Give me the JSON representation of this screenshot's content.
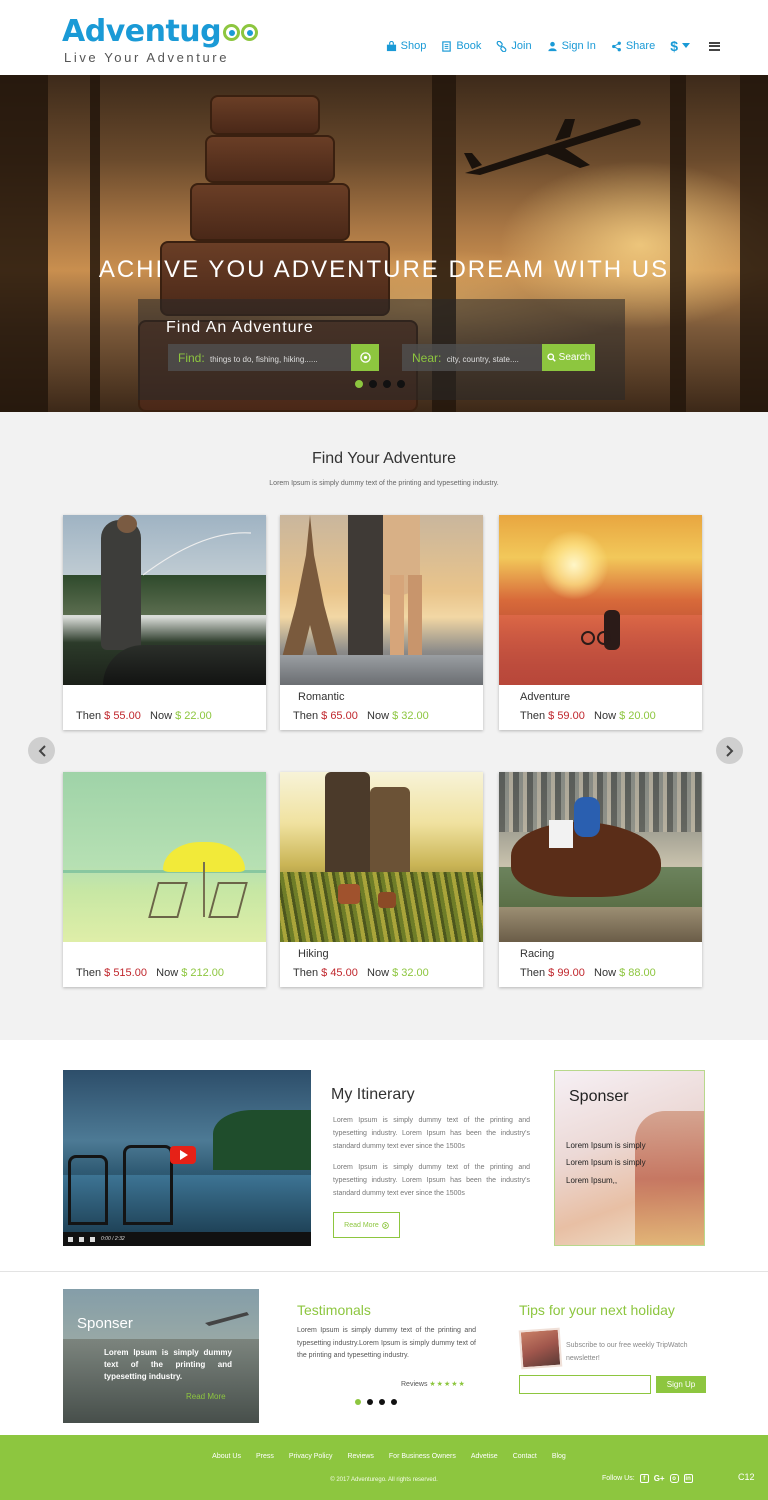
{
  "brand": {
    "name_main": "Adventu",
    "name_tail": "g",
    "tagline": "Live Your Adventure",
    "accent": "#8dc63f",
    "blue": "#1a9ad6"
  },
  "nav": {
    "shop": "Shop",
    "book": "Book",
    "join": "Join",
    "signin": "Sign In",
    "share": "Share",
    "currency": "$"
  },
  "hero": {
    "title": "ACHIVE YOU ADVENTURE DREAM WITH US",
    "search_heading": "Find An Adventure",
    "find_label": "Find:",
    "find_placeholder": "things to do, fishing, hiking......",
    "near_label": "Near:",
    "near_placeholder": "city, country, state....",
    "search_button": "Search",
    "slides": 4,
    "active_slide": 1
  },
  "adventures": {
    "title": "Find Your Adventure",
    "subtitle": "Lorem Ipsum is simply dummy text of the printing and typesetting industry.",
    "then_label": "Then",
    "now_label": "Now",
    "cards": [
      {
        "name": "",
        "then": "$ 55.00",
        "now": "$ 22.00",
        "image": "fishing"
      },
      {
        "name": "Romantic",
        "then": "$ 65.00",
        "now": "$ 32.00",
        "image": "eiffel-tower-couple"
      },
      {
        "name": "Adventure",
        "then": "$ 59.00",
        "now": "$ 20.00",
        "image": "desert-sunset-cyclist"
      },
      {
        "name": "",
        "then": "$ 515.00",
        "now": "$ 212.00",
        "image": "beach-umbrella"
      },
      {
        "name": "Hiking",
        "then": "$ 45.00",
        "now": "$ 32.00",
        "image": "hikers"
      },
      {
        "name": "Racing",
        "then": "$ 99.00",
        "now": "$ 88.00",
        "image": "horse-racing"
      }
    ]
  },
  "itinerary": {
    "title": "My Itinerary",
    "para1": "Lorem Ipsum is simply dummy text of the printing and typesetting industry. Lorem Ipsum has been the industry's standard dummy text ever since the 1500s",
    "para2": "Lorem Ipsum is simply dummy text of the printing and typesetting industry. Lorem Ipsum has been the industry's standard dummy text ever since the 1500s",
    "read_more": "Read More",
    "video_time": "0:00 / 2:32"
  },
  "sponser_card": {
    "title": "Sponser",
    "line1": "Lorem Ipsum is simply",
    "line2": "Lorem Ipsum is simply",
    "line3": "Lorem Ipsum,,"
  },
  "promo": {
    "title": "Sponser",
    "text": "Lorem Ipsum is simply dummy text of the printing and typesetting industry.",
    "link": "Read More"
  },
  "testimonials": {
    "title": "Testimonals",
    "text": "Lorem Ipsum is simply dummy text of the printing and typesetting industry.Lorem Ipsum is simply dummy text of the printing and typesetting industry.",
    "reviews_label": "Reviews",
    "stars": "★★★★★"
  },
  "tips": {
    "title": "Tips for your next holiday",
    "text": "Subscribe to our free weekly TripWatch newsletter!",
    "input_value": "",
    "signup": "Sign Up"
  },
  "footer": {
    "links": [
      "About Us",
      "Press",
      "Privacy Policy",
      "Reviews",
      "For Business Owners",
      "Advetise",
      "Contact",
      "Blog"
    ],
    "copyright": "© 2017 Adventurego. All rights reserved.",
    "follow": "Follow Us:",
    "code": "C12"
  }
}
